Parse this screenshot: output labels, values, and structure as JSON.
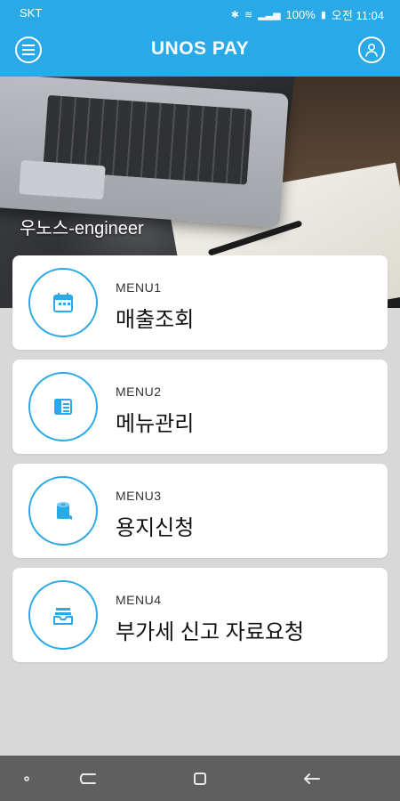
{
  "status_bar": {
    "carrier": "SKT",
    "battery": "100%",
    "time": "오전 11:04"
  },
  "app": {
    "title": "UNOS PAY"
  },
  "hero": {
    "text": "우노스-engineer"
  },
  "menus": [
    {
      "kicker": "MENU1",
      "label": "매출조회",
      "icon": "calendar-icon"
    },
    {
      "kicker": "MENU2",
      "label": "메뉴관리",
      "icon": "menu-book-icon"
    },
    {
      "kicker": "MENU3",
      "label": "용지신청",
      "icon": "paper-roll-icon"
    },
    {
      "kicker": "MENU4",
      "label": "부가세 신고 자료요청",
      "icon": "inbox-tray-icon"
    }
  ],
  "colors": {
    "primary": "#2aa9e8",
    "background": "#d8d8d8",
    "navbar": "#5f5f5f"
  }
}
